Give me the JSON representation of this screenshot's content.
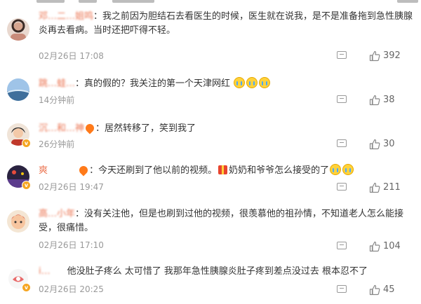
{
  "comments": [
    {
      "name": "邓…二…姐鸣",
      "separator": "：",
      "text": "我之前因为胆结石去看医生的时候，医生就在说我，是不是准备拖到急性胰腺炎再去看病。当时还把吓得不轻。",
      "time": "02月26日 17:08",
      "likes": "392",
      "verified": false,
      "suffix": []
    },
    {
      "name": "跳…蛙…",
      "separator": "：",
      "text": "真的假的？我关注的第一个天津网红",
      "time": "14分钟前",
      "likes": "38",
      "verified": false,
      "suffix": [
        "cry-emoji",
        "cry-emoji",
        "cry-emoji"
      ]
    },
    {
      "name": "沉…和…神",
      "separator": "",
      "text": "：居然转移了，笑到我了",
      "time": "26分钟前",
      "likes": "30",
      "verified": true,
      "suffix": []
    },
    {
      "name": "爽",
      "separator": "",
      "text": "：今天还刷到了他以前的视频。",
      "text2": "奶奶和爷爷怎么接受的了",
      "time": "02月26日 19:47",
      "likes": "211",
      "verified": true,
      "suffix": []
    },
    {
      "name": "高…小年",
      "separator": "：",
      "text": "没有关注他，但是也刷到过他的视频，很羡慕他的祖孙情，不知道老人怎么能接受，很痛惜。",
      "time": "02月26日 17:10",
      "likes": "104",
      "verified": false,
      "suffix": []
    },
    {
      "name": "i…",
      "separator": "",
      "text": "他没肚子疼么 太可惜了 我那年急性胰腺炎肚子疼到差点没过去 根本忍不了",
      "time": "02月26日 20:25",
      "likes": "45",
      "verified": true,
      "suffix": []
    }
  ],
  "icons": {
    "comment": "comment-icon",
    "like": "thumbs-up-icon"
  }
}
